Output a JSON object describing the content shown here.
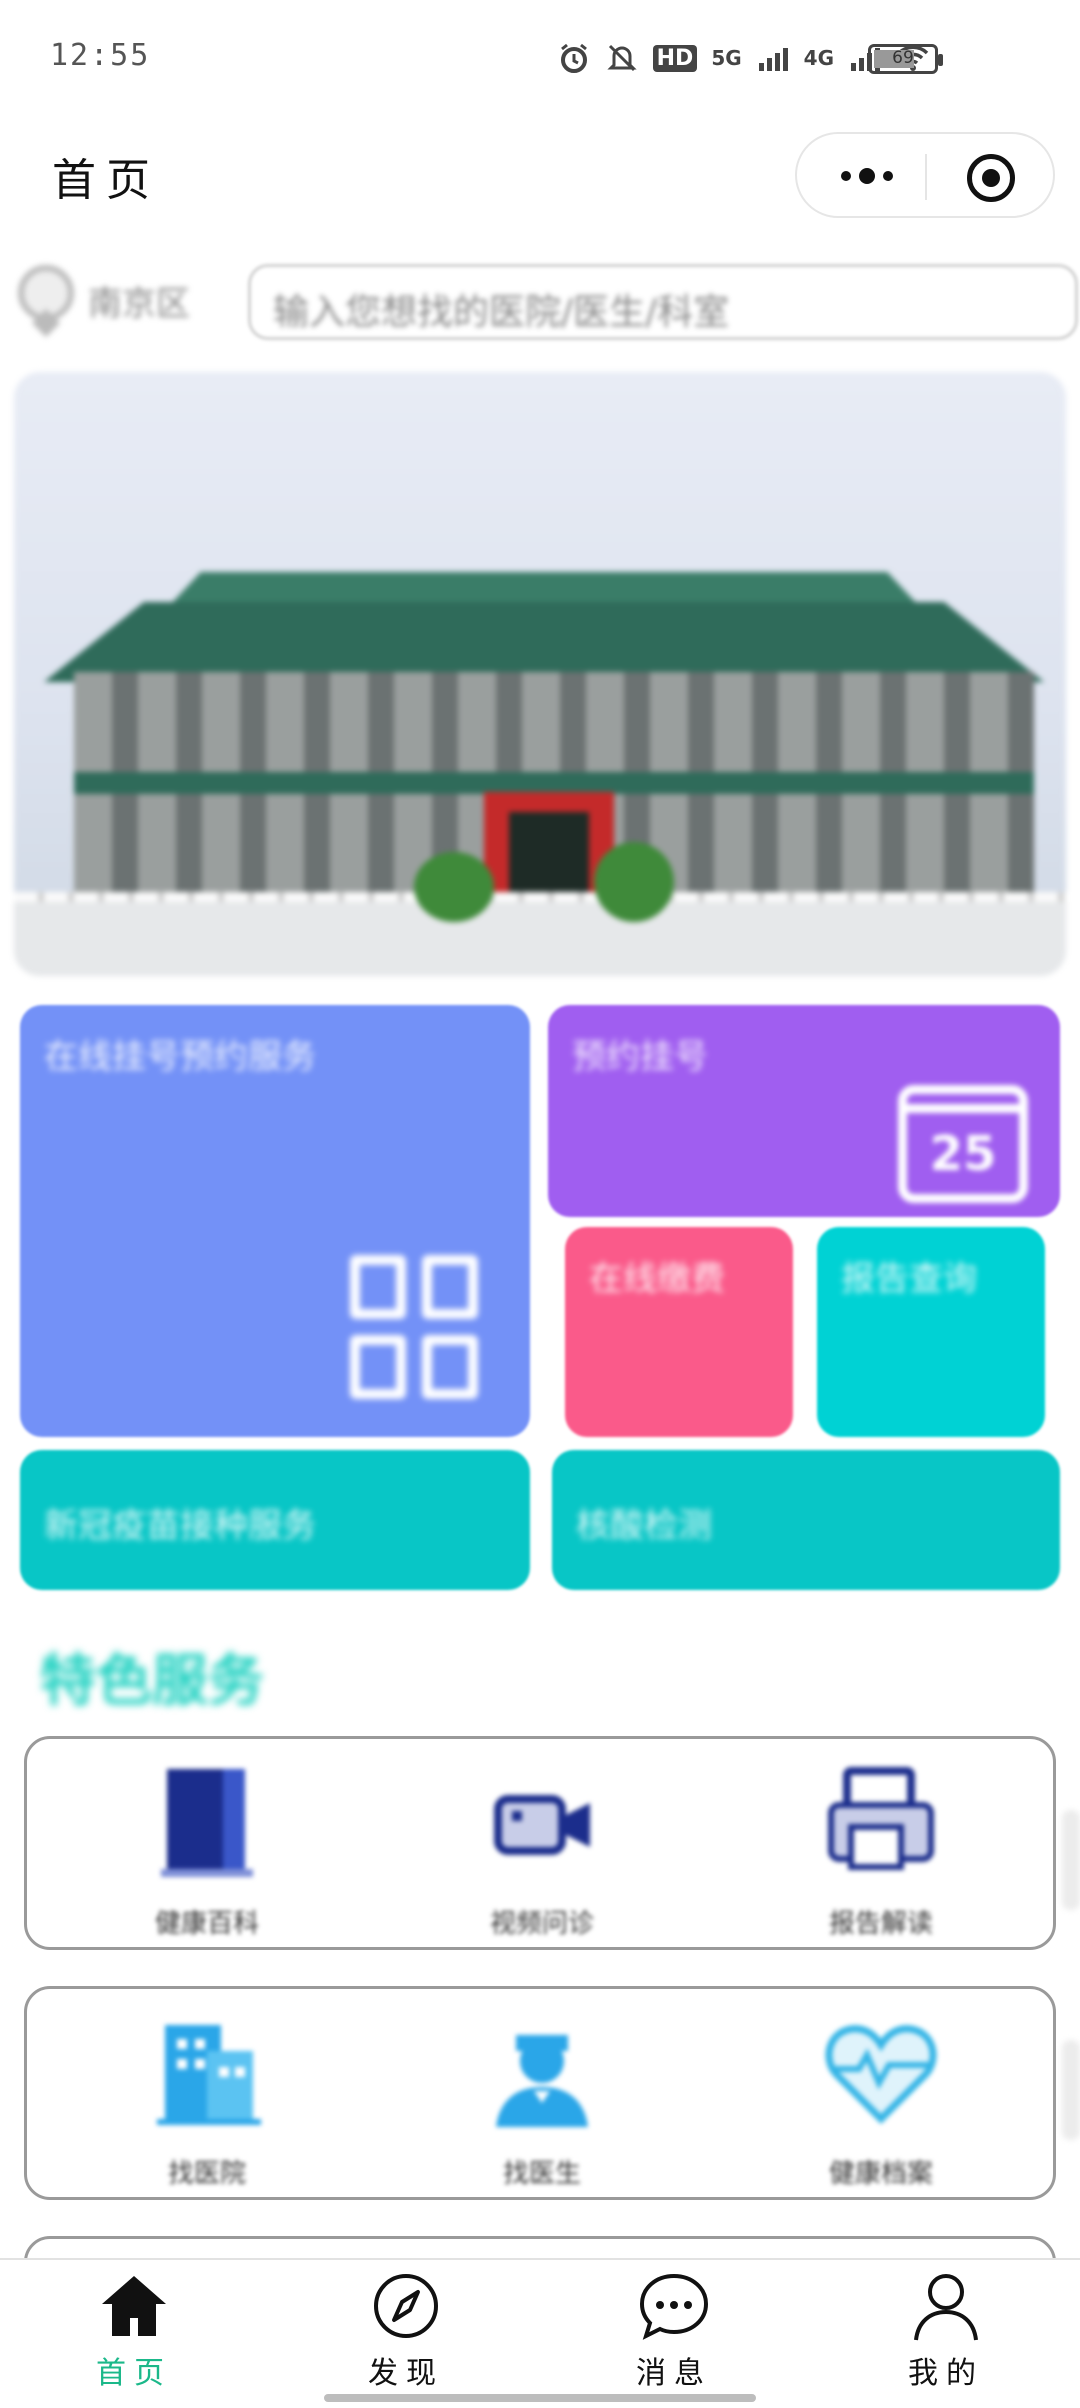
{
  "status_bar": {
    "time": "12:55",
    "network_hd": "HD",
    "network_5g": "5G",
    "network_4g": "4G",
    "battery_level": "69"
  },
  "header": {
    "title": "首页"
  },
  "search": {
    "location": "南京区",
    "placeholder": "输入您想找的医院/医生/科室"
  },
  "tiles": {
    "blue_label": "在线挂号预约服务",
    "purple_label": "预约挂号",
    "calendar_number": "25",
    "pink_label": "在线缴费",
    "cyan_label": "报告查询",
    "teal1_label": "新冠疫苗接种服务",
    "teal2_label": "核酸检测"
  },
  "feature_section": {
    "title": "特色服务"
  },
  "services_row1": [
    {
      "label": "健康百科",
      "icon": "book-icon"
    },
    {
      "label": "视频问诊",
      "icon": "video-icon"
    },
    {
      "label": "报告解读",
      "icon": "printer-icon"
    }
  ],
  "services_row2": [
    {
      "label": "找医院",
      "icon": "hospital-icon"
    },
    {
      "label": "找医生",
      "icon": "doctor-icon"
    },
    {
      "label": "健康档案",
      "icon": "heart-icon"
    }
  ],
  "tabbar": {
    "items": [
      {
        "label": "首页",
        "icon": "home-icon",
        "active": true
      },
      {
        "label": "发现",
        "icon": "compass-icon",
        "active": false
      },
      {
        "label": "消息",
        "icon": "chat-icon",
        "active": false
      },
      {
        "label": "我的",
        "icon": "user-icon",
        "active": false
      }
    ],
    "active_color": "#1bb88a"
  },
  "colors": {
    "tile_blue": "#7391f7",
    "tile_purple": "#a05ef0",
    "tile_pink": "#fa5a8a",
    "tile_cyan": "#00d2d4",
    "tile_teal": "#08c6c6",
    "feature_title": "#1fd1c1"
  }
}
